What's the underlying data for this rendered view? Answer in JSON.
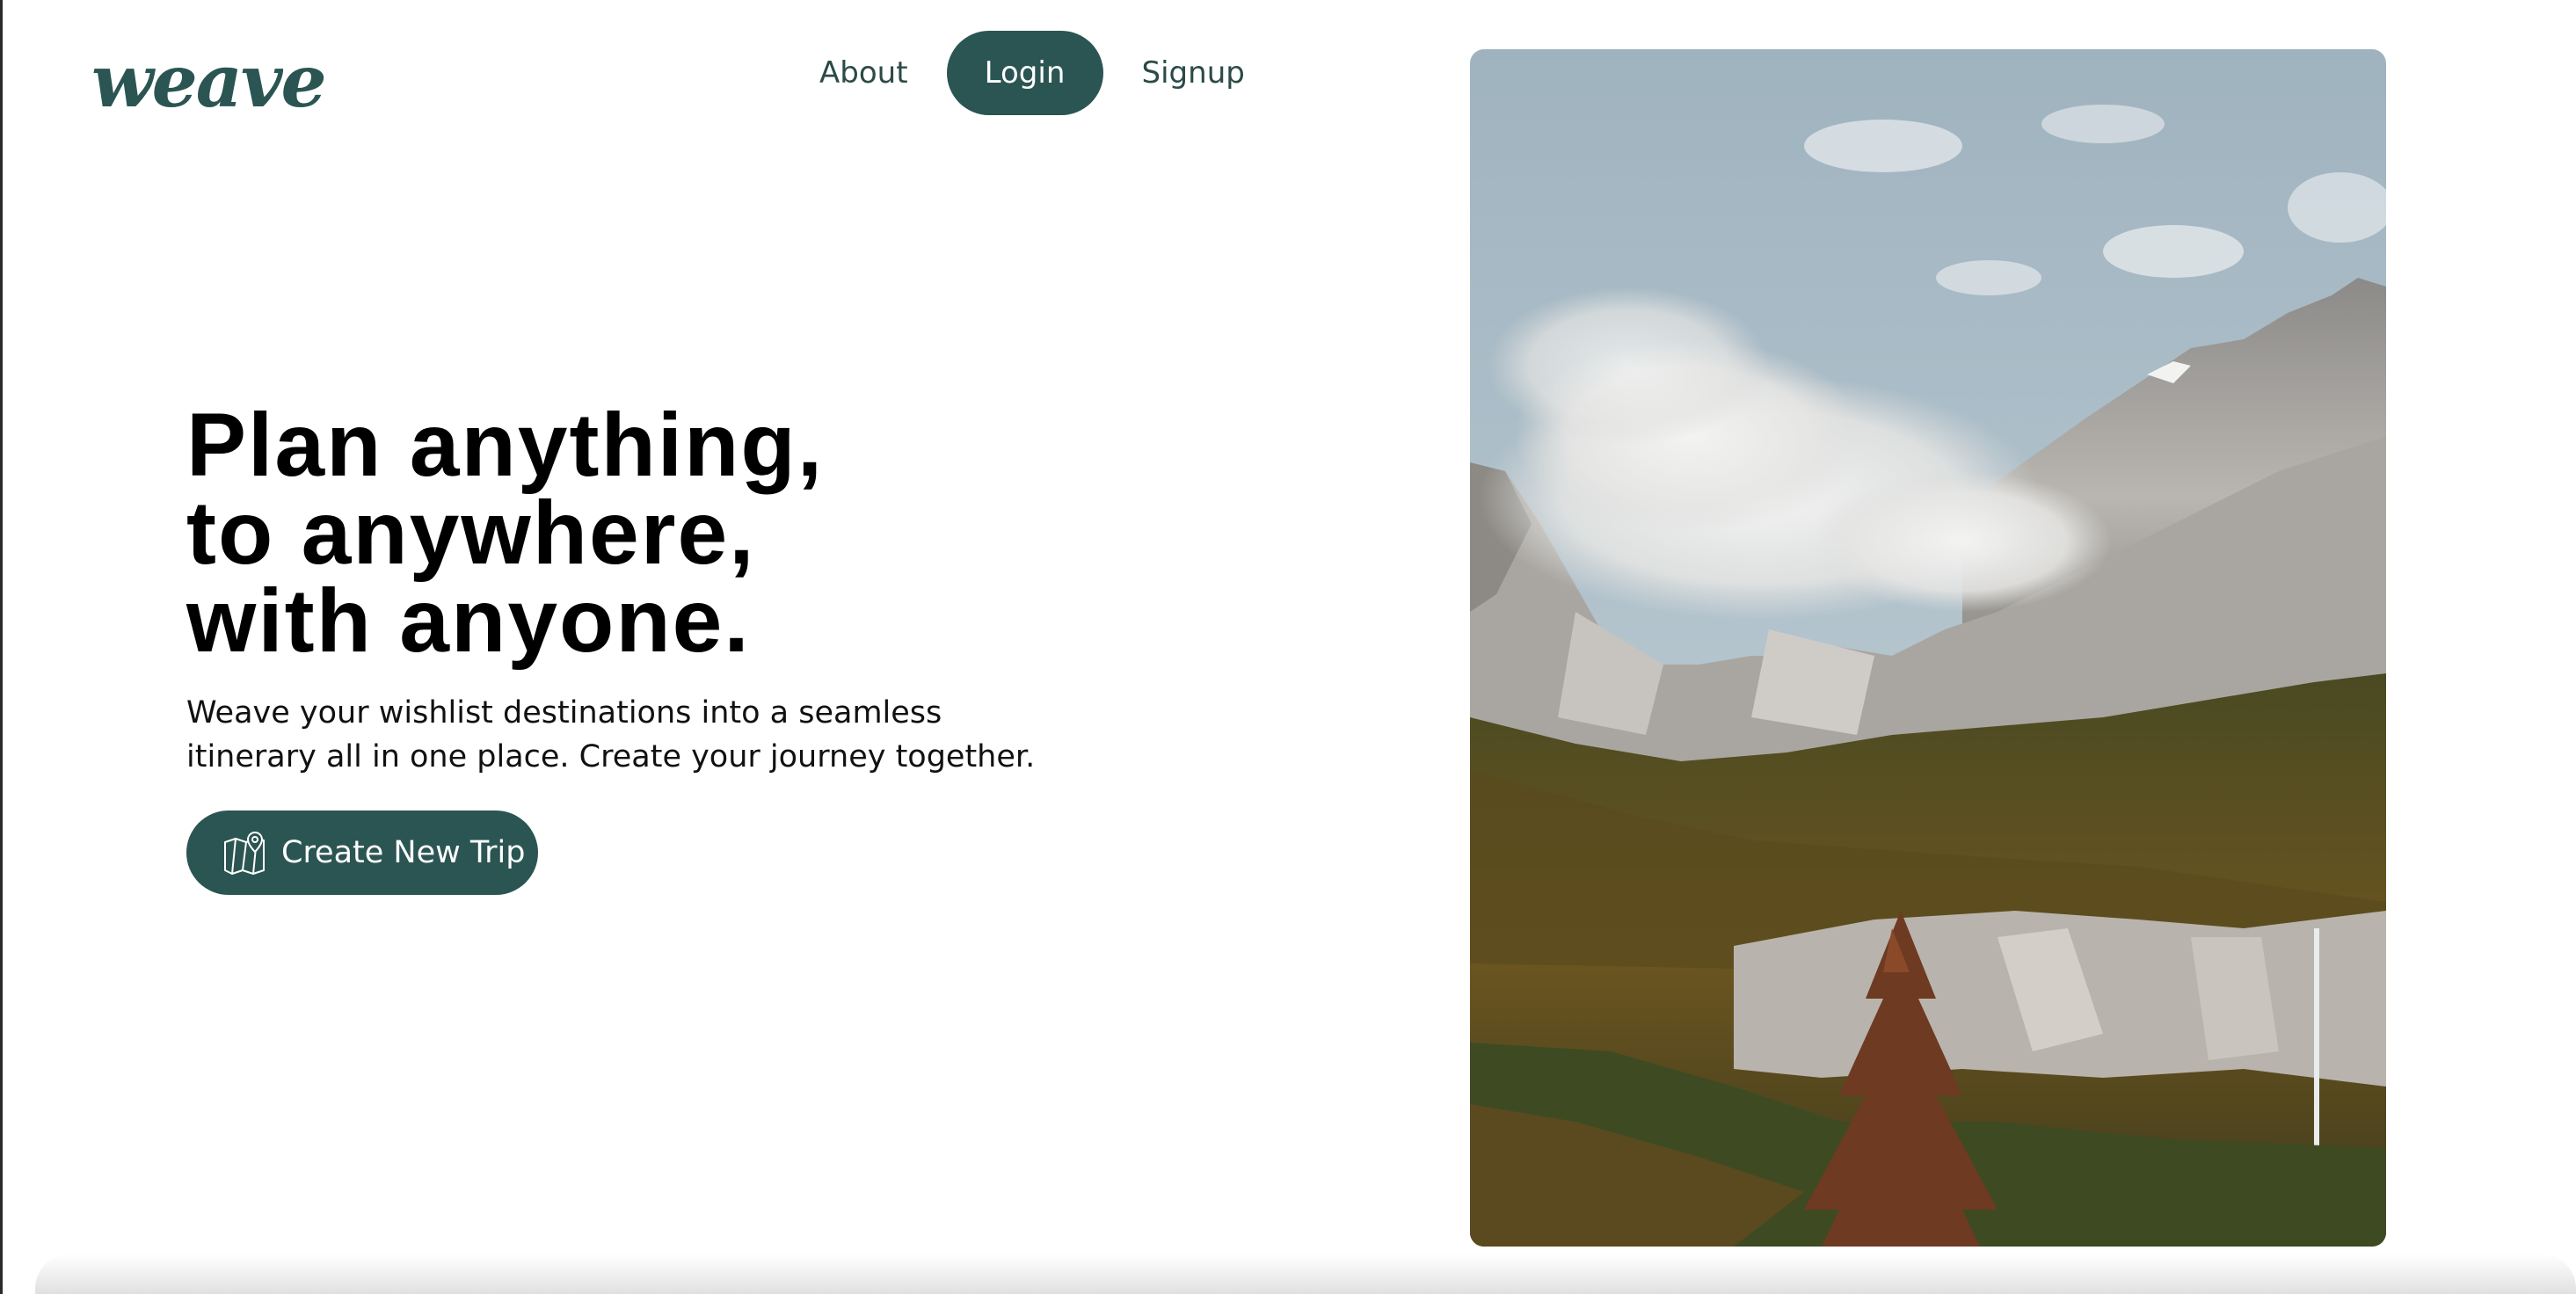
{
  "brand": {
    "logo_text": "weave",
    "primary_color": "#2b5552"
  },
  "nav": {
    "about_label": "About",
    "login_label": "Login",
    "signup_label": "Signup"
  },
  "hero": {
    "headline_lines": [
      "Plan anything,",
      "to anywhere,",
      "with anyone."
    ],
    "subtitle_lines": [
      "Weave your wishlist destinations into a seamless",
      "itinerary all in one place. Create your journey together."
    ],
    "cta_label": "Create New Trip",
    "cta_icon": "map-pin-icon"
  },
  "image": {
    "subject": "mountain-landscape"
  }
}
